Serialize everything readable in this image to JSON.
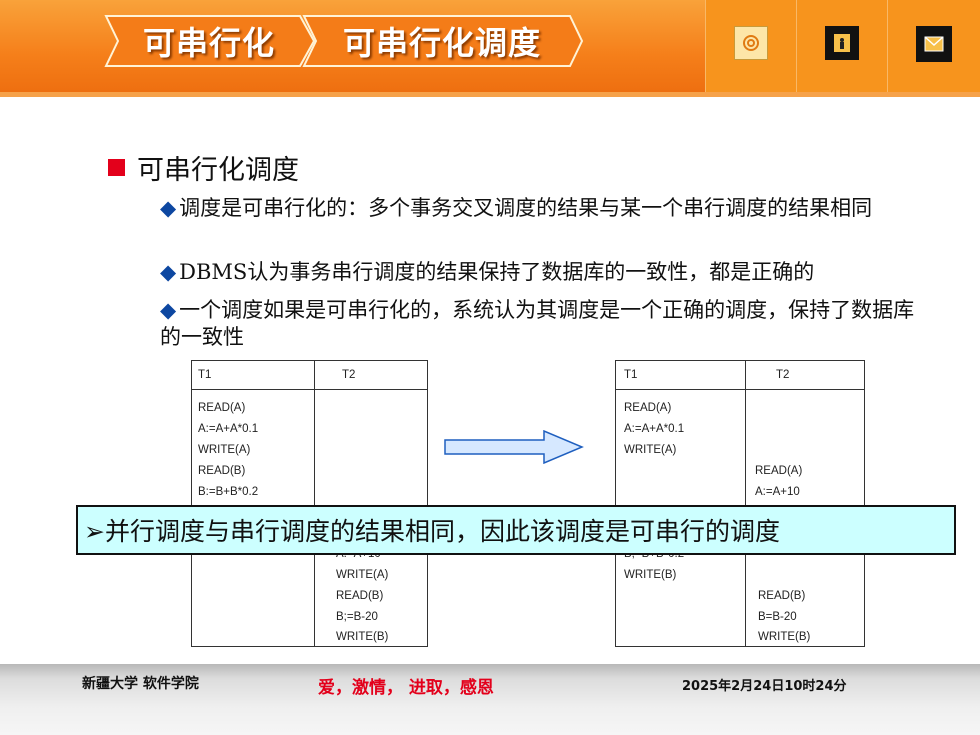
{
  "header": {
    "tab1_label": "可串行化",
    "tab2_label": "可串行化调度",
    "icons": [
      "target-icon",
      "exit-door-icon",
      "mail-icon"
    ],
    "colors": {
      "header": "#f57f1a",
      "tab": "#f7941d",
      "accent_red": "#e3001b"
    }
  },
  "main": {
    "heading": "可串行化调度",
    "bullets": [
      {
        "text": "调度是可串行化的：多个事务交叉调度的结果与某一个串行调度的结果相同"
      },
      {
        "text": "DBMS认为事务串行调度的结果保持了数据库的一致性，都是正确的"
      },
      {
        "text": "一个调度如果是可串行化的，系统认为其调度是一个正确的调度，保持了数据库的一致性"
      }
    ]
  },
  "left_schedule": {
    "headers": [
      "T1",
      "T2"
    ],
    "t1_ops": [
      "READ(A)",
      "A:=A+A*0.1",
      "WRITE(A)",
      "READ(B)",
      "B:=B+B*0.2"
    ],
    "t2_partial": "A:=A+10",
    "t2_ops": [
      "WRITE(A)",
      "READ(B)",
      "B;=B-20",
      "WRITE(B)"
    ]
  },
  "right_schedule": {
    "headers": [
      "T1",
      "T2"
    ],
    "t1_ops": [
      "READ(A)",
      "A:=A+A*0.1",
      "WRITE(A)"
    ],
    "t2_ops": [
      "READ(A)",
      "A:=A+10"
    ],
    "t1_partial": "B;=B+B*0.2",
    "t1_ops_after": [
      "WRITE(B)"
    ],
    "t2_ops_after": [
      "READ(B)",
      "B=B-20",
      "WRITE(B)"
    ]
  },
  "banner": {
    "text": "➢并行调度与串行调度的结果相同，因此该调度是可串行的调度"
  },
  "footer": {
    "org": "新疆大学  软件学院",
    "motto": "爱，激情， 进取，感恩",
    "datetime": "2025年2月24日10时24分",
    "motto_color": "#e3001b"
  }
}
